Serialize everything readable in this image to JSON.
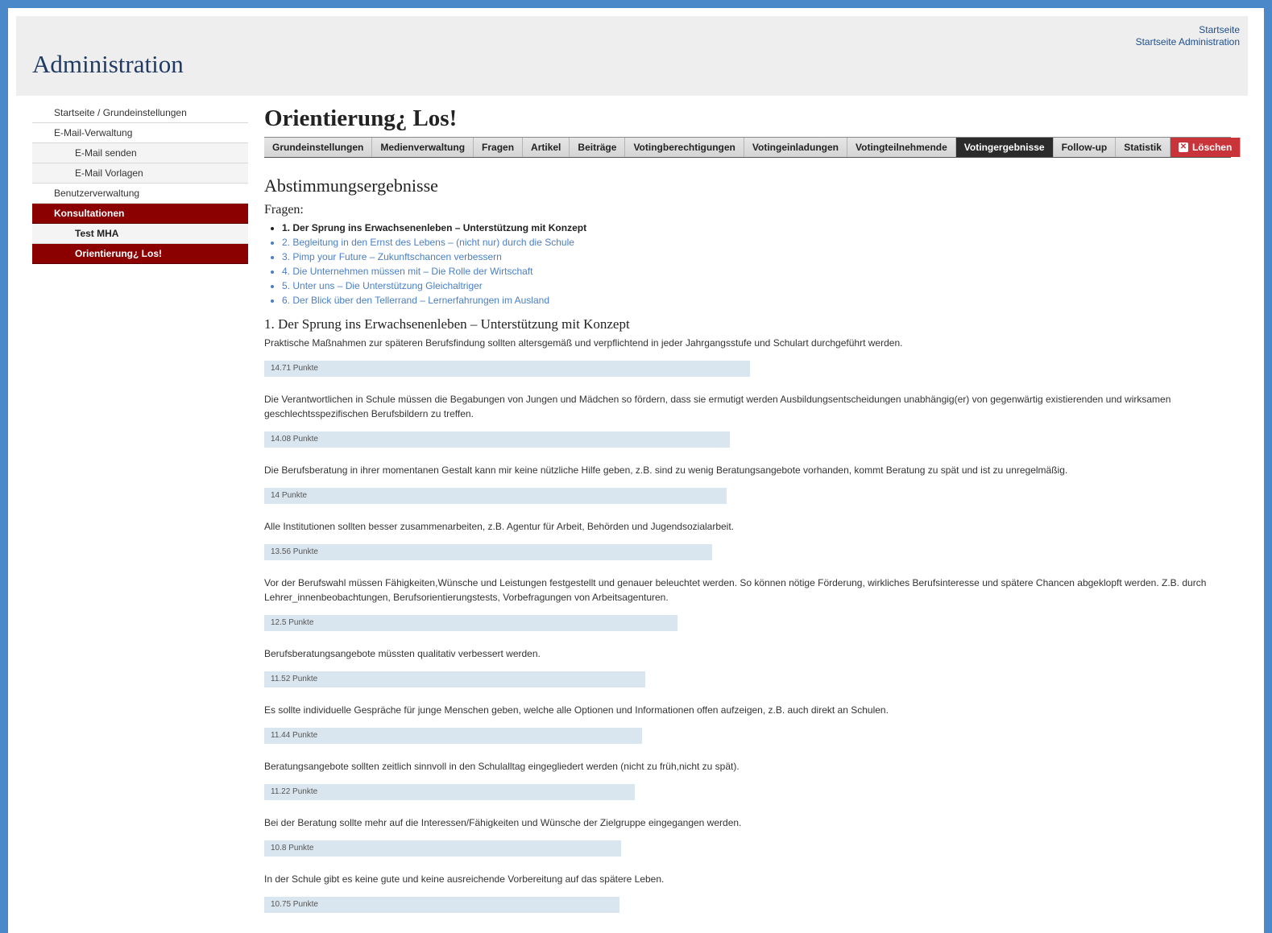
{
  "header": {
    "title": "Administration",
    "links": [
      "Startseite",
      "Startseite Administration"
    ]
  },
  "sidebar": {
    "items": [
      {
        "label": "Startseite / Grundeinstellungen",
        "level": 0,
        "state": "normal"
      },
      {
        "label": "E-Mail-Verwaltung",
        "level": 0,
        "state": "normal"
      },
      {
        "label": "E-Mail senden",
        "level": 1,
        "state": "normal"
      },
      {
        "label": "E-Mail Vorlagen",
        "level": 1,
        "state": "normal"
      },
      {
        "label": "Benutzerverwaltung",
        "level": 0,
        "state": "normal"
      },
      {
        "label": "Konsultationen",
        "level": 0,
        "state": "active"
      },
      {
        "label": "Test MHA",
        "level": 1,
        "state": "bold"
      },
      {
        "label": "Orientierung¿ Los!",
        "level": 1,
        "state": "active"
      }
    ]
  },
  "main": {
    "title": "Orientierung¿ Los!",
    "tabs": [
      {
        "label": "Grundeinstellungen",
        "state": "normal"
      },
      {
        "label": "Medienverwaltung",
        "state": "normal"
      },
      {
        "label": "Fragen",
        "state": "normal"
      },
      {
        "label": "Artikel",
        "state": "normal"
      },
      {
        "label": "Beiträge",
        "state": "normal"
      },
      {
        "label": "Votingberechtigungen",
        "state": "normal"
      },
      {
        "label": "Votingeinladungen",
        "state": "normal"
      },
      {
        "label": "Votingteilnehmende",
        "state": "normal"
      },
      {
        "label": "Votingergebnisse",
        "state": "active"
      },
      {
        "label": "Follow-up",
        "state": "normal"
      },
      {
        "label": "Statistik",
        "state": "normal"
      },
      {
        "label": "Löschen",
        "state": "danger",
        "icon": "close-icon"
      }
    ],
    "section_title": "Abstimmungsergebnisse",
    "fragen_label": "Fragen:",
    "questions": [
      {
        "num": "1.",
        "text": "Der Sprung ins Erwachsenenleben – Unterstützung mit Konzept",
        "current": true
      },
      {
        "num": "2.",
        "text": "Begleitung in den Ernst des Lebens – (nicht nur) durch die Schule",
        "current": false
      },
      {
        "num": "3.",
        "text": "Pimp your Future – Zukunftschancen verbessern",
        "current": false
      },
      {
        "num": "4.",
        "text": "Die Unternehmen müssen mit – Die Rolle der Wirtschaft",
        "current": false
      },
      {
        "num": "5.",
        "text": "Unter uns – Die Unterstützung Gleichaltriger",
        "current": false
      },
      {
        "num": "6.",
        "text": "Der Blick über den Tellerrand – Lernerfahrungen im Ausland",
        "current": false
      }
    ],
    "question_heading": "1. Der Sprung ins Erwachsenenleben – Unterstützung mit Konzept",
    "max_points": 29.3,
    "answers": [
      {
        "text": "Praktische Maßnahmen zur späteren Berufsfindung sollten altersgemäß und verpflichtend in jeder Jahrgangsstufe und Schulart durchgeführt werden.",
        "points": 14.71,
        "label": "14.71 Punkte"
      },
      {
        "text": "Die Verantwortlichen in Schule müssen die Begabungen von Jungen und Mädchen so fördern, dass sie ermutigt werden Ausbildungsentscheidungen unabhängig(er) von gegenwärtig existierenden und wirksamen geschlechtsspezifischen Berufsbildern zu treffen.",
        "points": 14.08,
        "label": "14.08 Punkte"
      },
      {
        "text": "Die Berufsberatung in ihrer momentanen Gestalt kann mir keine nützliche Hilfe geben, z.B. sind zu wenig Beratungsangebote vorhanden, kommt Beratung zu spät und ist zu unregelmäßig.",
        "points": 14,
        "label": "14 Punkte"
      },
      {
        "text": "Alle Institutionen sollten besser zusammenarbeiten, z.B. Agentur für Arbeit, Behörden und Jugendsozialarbeit.",
        "points": 13.56,
        "label": "13.56 Punkte"
      },
      {
        "text": "Vor der Berufswahl müssen Fähigkeiten,Wünsche und Leistungen festgestellt und genauer beleuchtet werden. So können nötige Förderung, wirkliches Berufsinteresse und spätere Chancen abgeklopft werden. Z.B. durch Lehrer_innenbeobachtungen, Berufsorientierungstests, Vorbefragungen von Arbeitsagenturen.",
        "points": 12.5,
        "label": "12.5 Punkte"
      },
      {
        "text": "Berufsberatungsangebote müssten qualitativ verbessert werden.",
        "points": 11.52,
        "label": "11.52 Punkte"
      },
      {
        "text": "Es sollte individuelle Gespräche für junge Menschen geben, welche alle Optionen und Informationen offen aufzeigen, z.B. auch direkt an Schulen.",
        "points": 11.44,
        "label": "11.44 Punkte"
      },
      {
        "text": "Beratungsangebote sollten zeitlich sinnvoll in den Schulalltag eingegliedert werden (nicht zu früh,nicht zu spät).",
        "points": 11.22,
        "label": "11.22 Punkte"
      },
      {
        "text": "Bei der Beratung sollte mehr auf die Interessen/Fähigkeiten und Wünsche der Zielgruppe eingegangen werden.",
        "points": 10.8,
        "label": "10.8 Punkte"
      },
      {
        "text": "In der Schule gibt es keine gute und keine ausreichende Vorbereitung auf das spätere Leben.",
        "points": 10.75,
        "label": "10.75 Punkte"
      }
    ]
  }
}
